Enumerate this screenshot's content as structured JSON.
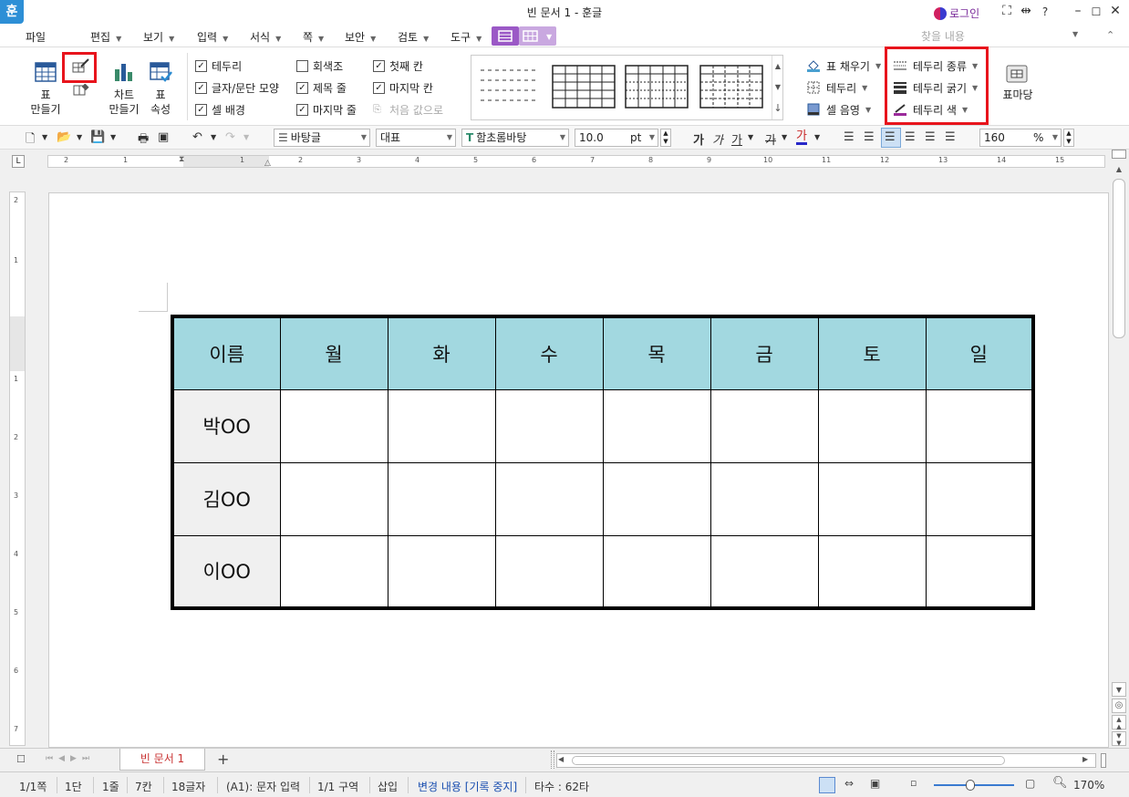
{
  "window": {
    "app_icon": "훈",
    "title": "빈 문서 1 - 훈글",
    "login": "로그인",
    "buttons": [
      "fullscreen-icon",
      "restore-arrows-icon",
      "help-icon",
      "minimize-icon",
      "maximize-icon",
      "close-icon"
    ]
  },
  "menu": {
    "items": [
      "파일",
      "편집",
      "보기",
      "입력",
      "서식",
      "쪽",
      "보안",
      "검토",
      "도구"
    ],
    "search_placeholder": "찾을 내용"
  },
  "ribbon": {
    "table_make": "표\n만들기",
    "chart_make": "차트\n만들기",
    "table_props": "표\n속성",
    "checks": [
      {
        "label": "테두리",
        "checked": true
      },
      {
        "label": "글자/문단 모양",
        "checked": true
      },
      {
        "label": "셀 배경",
        "checked": true
      },
      {
        "label": "회색조",
        "checked": false
      },
      {
        "label": "제목 줄",
        "checked": true
      },
      {
        "label": "마지막 줄",
        "checked": true
      },
      {
        "label": "첫째 칸",
        "checked": true
      },
      {
        "label": "마지막 칸",
        "checked": true
      },
      {
        "label": "처음 값으로",
        "checked": false,
        "disabled": true
      }
    ],
    "fill_menu": [
      "표 채우기",
      "테두리",
      "셀 음영"
    ],
    "border_menu": [
      "테두리 종류",
      "테두리 굵기",
      "테두리 색"
    ],
    "table_template": "표마당"
  },
  "toolbar": {
    "style": "바탕글",
    "font_lang": "대표",
    "font": "함초롬바탕",
    "size": "10.0",
    "unit": "pt",
    "zoom_value": "160",
    "zoom_unit": "%"
  },
  "ruler": {
    "h_ticks": [
      "2",
      "1",
      "1",
      "2",
      "3",
      "4",
      "5",
      "6",
      "7",
      "8",
      "9",
      "10",
      "11",
      "12",
      "13",
      "14",
      "15"
    ],
    "v_ticks": [
      "2",
      "1",
      "1",
      "2",
      "3",
      "4",
      "5",
      "6",
      "7"
    ]
  },
  "table": {
    "header": [
      "이름",
      "월",
      "화",
      "수",
      "목",
      "금",
      "토",
      "일"
    ],
    "rows": [
      [
        "박OO",
        "",
        "",
        "",
        "",
        "",
        "",
        ""
      ],
      [
        "김OO",
        "",
        "",
        "",
        "",
        "",
        "",
        ""
      ],
      [
        "이OO",
        "",
        "",
        "",
        "",
        "",
        "",
        ""
      ]
    ]
  },
  "tabs": {
    "doc_tab": "빈 문서 1",
    "add": "+"
  },
  "status": {
    "page": "1/1쪽",
    "col": "1단",
    "line": "1줄",
    "cell": "7칸",
    "chars": "18글자",
    "mode": "(A1): 문자 입력",
    "section": "1/1 구역",
    "insert": "삽입",
    "track": "변경 내용 [기록 중지]",
    "keystrokes": "타수 : 62타",
    "zoom": "170%",
    "zoom_level": 0.45
  }
}
